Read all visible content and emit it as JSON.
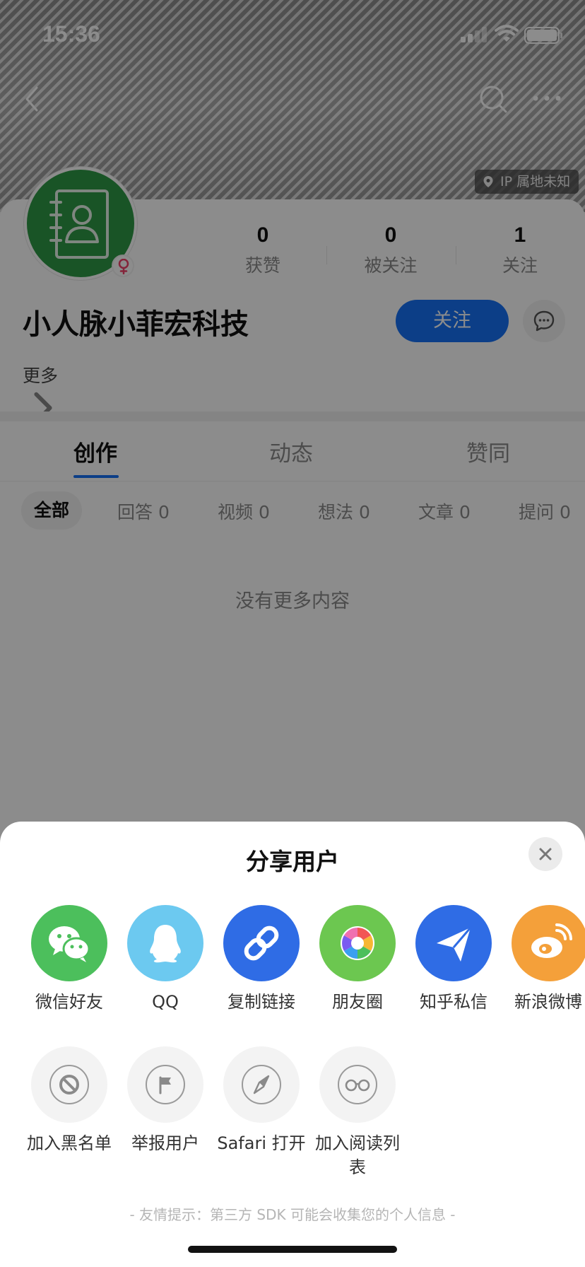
{
  "status_bar": {
    "time": "15:36"
  },
  "profile": {
    "ip_location": "IP 属地未知",
    "name": "小人脉小菲宏科技",
    "stats": [
      {
        "value": "0",
        "label": "获赞"
      },
      {
        "value": "0",
        "label": "被关注"
      },
      {
        "value": "1",
        "label": "关注"
      }
    ],
    "follow_label": "关注",
    "more_label": "更多"
  },
  "tabs": [
    {
      "label": "创作",
      "active": true
    },
    {
      "label": "动态",
      "active": false
    },
    {
      "label": "赞同",
      "active": false
    }
  ],
  "filters": [
    {
      "label": "全部",
      "active": true
    },
    {
      "label": "回答 0"
    },
    {
      "label": "视频 0"
    },
    {
      "label": "想法 0"
    },
    {
      "label": "文章 0"
    },
    {
      "label": "提问 0"
    }
  ],
  "empty_message": "没有更多内容",
  "share_sheet": {
    "title": "分享用户",
    "targets": [
      {
        "label": "微信好友",
        "icon": "wechat-icon",
        "color": "#4cbf5c"
      },
      {
        "label": "QQ",
        "icon": "qq-icon",
        "color": "#6cc9f0"
      },
      {
        "label": "复制链接",
        "icon": "link-icon",
        "color": "#2f6ce5"
      },
      {
        "label": "朋友圈",
        "icon": "moments-icon",
        "color": "#6cc750"
      },
      {
        "label": "知乎私信",
        "icon": "send-icon",
        "color": "#2f6ce5"
      },
      {
        "label": "新浪微博",
        "icon": "weibo-icon",
        "color": "#f4a03a"
      }
    ],
    "actions": [
      {
        "label": "加入黑名单",
        "icon": "block-icon"
      },
      {
        "label": "举报用户",
        "icon": "flag-icon"
      },
      {
        "label": "Safari 打开",
        "icon": "compass-icon"
      },
      {
        "label": "加入阅读列表",
        "icon": "glasses-icon"
      }
    ],
    "tip": "- 友情提示：第三方 SDK 可能会收集您的个人信息 -"
  }
}
